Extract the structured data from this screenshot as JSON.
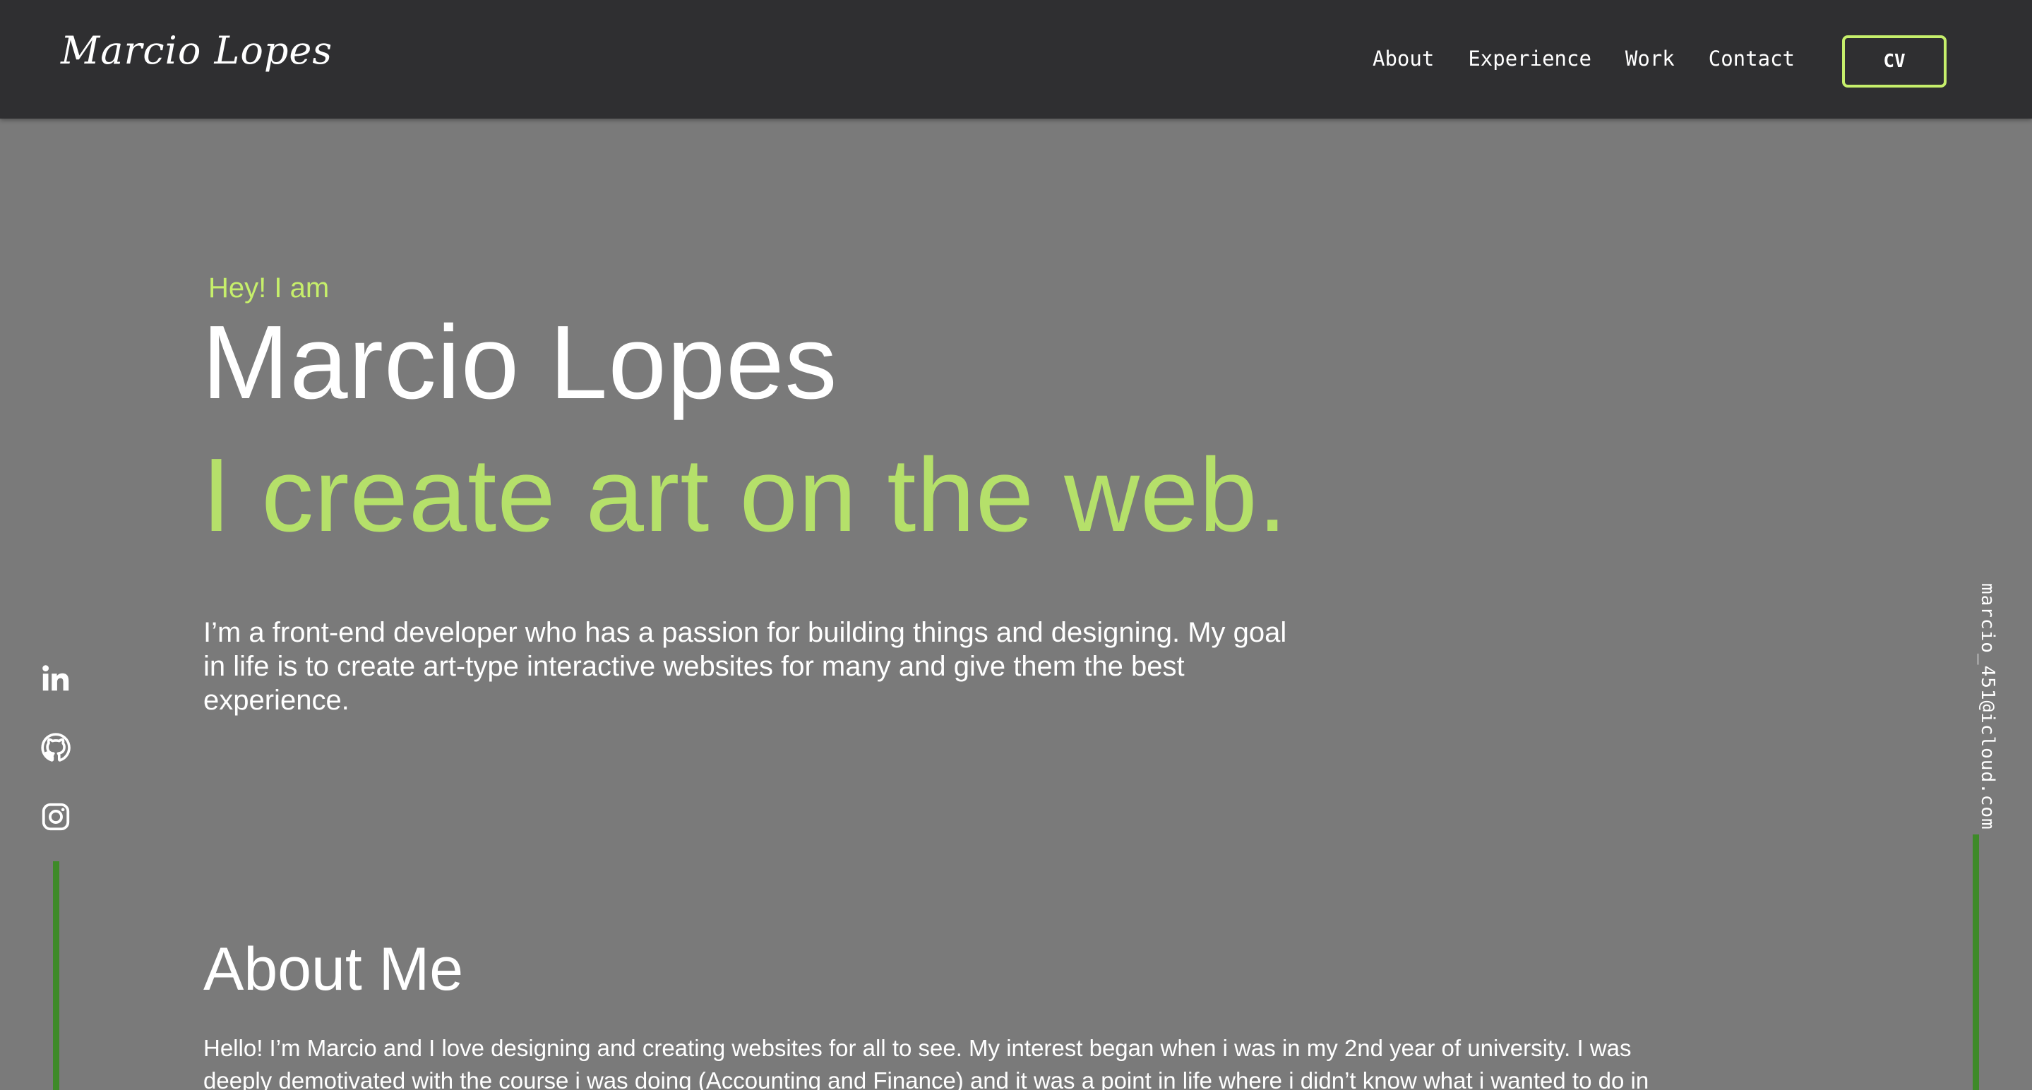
{
  "header": {
    "logo": "Marcio Lopes",
    "nav": [
      {
        "label": "About"
      },
      {
        "label": "Experience"
      },
      {
        "label": "Work"
      },
      {
        "label": "Contact"
      }
    ],
    "cv_label": "CV"
  },
  "hero": {
    "greeting": "Hey! I am",
    "name": "Marcio Lopes",
    "tagline": "I create art on the web.",
    "intro": "I’m a front-end developer who has a passion for building things and designing. My goal in life is to create art-type interactive websites for many and give them the best experience."
  },
  "about": {
    "title": "About Me",
    "text": "Hello! I’m Marcio and I love designing and creating websites for all to see. My interest began when i was in my 2nd year of university. I was deeply demotivated with the course i was doing (Accounting and Finance) and it was a point in life where i didn’t know what i wanted to do in"
  },
  "socials": [
    {
      "icon": "linkedin-icon"
    },
    {
      "icon": "github-icon"
    },
    {
      "icon": "instagram-icon"
    }
  ],
  "email": "marcio_451@icloud.com",
  "colors": {
    "background": "#7a7a7a",
    "header": "#2f2f31",
    "accent": "#c6ef6b",
    "tagline": "#b5e06a",
    "line": "#3e8a28",
    "text": "#ffffff"
  }
}
